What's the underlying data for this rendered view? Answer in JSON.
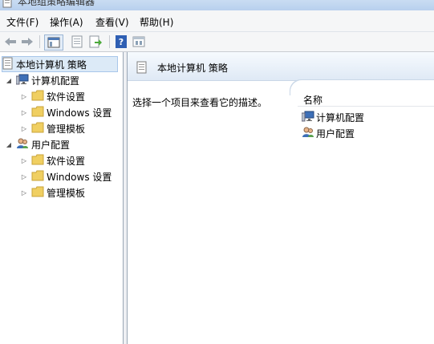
{
  "window": {
    "title": "本地组策略编辑器"
  },
  "menu": [
    {
      "label": "文件(F)"
    },
    {
      "label": "操作(A)"
    },
    {
      "label": "查看(V)"
    },
    {
      "label": "帮助(H)"
    }
  ],
  "toolbar": {
    "icons": [
      "back-arrow-icon",
      "forward-arrow-icon",
      "show-tree-icon",
      "properties-icon",
      "export-list-icon",
      "help-icon",
      "filter-view-icon"
    ],
    "colors": {
      "help_icon": "#2f5fb3",
      "folder": "#f0cf61"
    }
  },
  "tree": {
    "root": "本地计算机 策略",
    "computer": {
      "label": "计算机配置",
      "children": [
        {
          "label": "软件设置"
        },
        {
          "label": "Windows 设置"
        },
        {
          "label": "管理模板"
        }
      ]
    },
    "user": {
      "label": "用户配置",
      "children": [
        {
          "label": "软件设置"
        },
        {
          "label": "Windows 设置"
        },
        {
          "label": "管理模板"
        }
      ]
    }
  },
  "right": {
    "header": "本地计算机 策略",
    "description": "选择一个项目来查看它的描述。",
    "column_name": "名称",
    "items": [
      {
        "label": "计算机配置",
        "icon": "computer-icon"
      },
      {
        "label": "用户配置",
        "icon": "users-icon"
      }
    ]
  }
}
